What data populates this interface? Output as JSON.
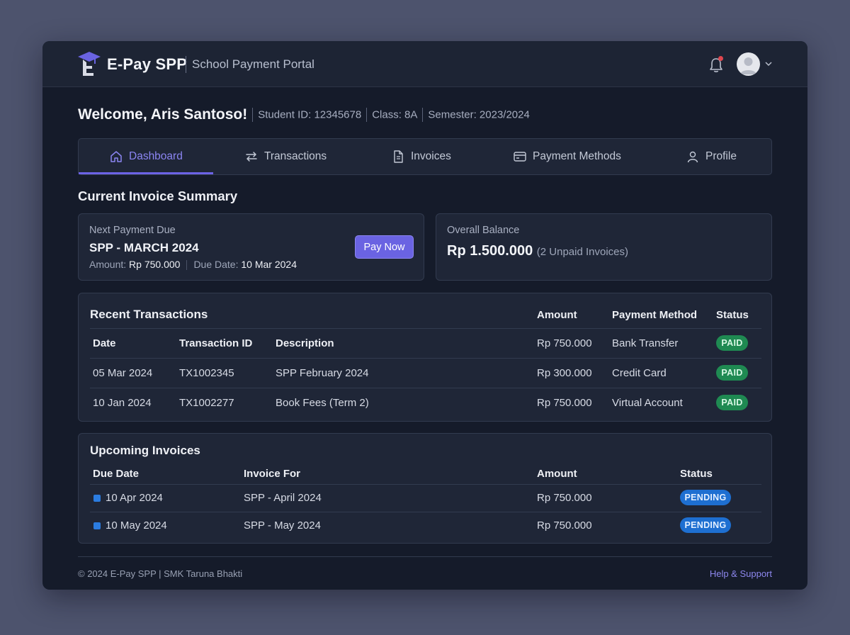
{
  "app": {
    "brand": "E-Pay SPP",
    "subtitle": "School Payment Portal"
  },
  "colors": {
    "accent": "#6a63e2",
    "paid": "#1f8a52",
    "pending": "#1e6fd1",
    "notification_dot": "#e0464e"
  },
  "header": {
    "notification_icon": "bell-icon",
    "avatar_icon": "user-avatar",
    "menu_icon": "chevron-down-icon"
  },
  "welcome": {
    "title": "Welcome, Aris Santoso!",
    "student_id": "Student ID: 12345678",
    "class": "Class: 8A",
    "semester": "Semester: 2023/2024"
  },
  "tabs": [
    {
      "label": "Dashboard",
      "icon": "home-icon",
      "active": true
    },
    {
      "label": "Transactions",
      "icon": "swap-icon",
      "active": false
    },
    {
      "label": "Invoices",
      "icon": "document-icon",
      "active": false
    },
    {
      "label": "Payment Methods",
      "icon": "card-icon",
      "active": false
    },
    {
      "label": "Profile",
      "icon": "user-icon",
      "active": false
    }
  ],
  "summary": {
    "title": "Current Invoice Summary",
    "next_due": {
      "label": "Next Payment Due",
      "title": "SPP - MARCH 2024",
      "amount_label": "Amount:",
      "amount": "Rp 750.000",
      "due_label": "Due Date:",
      "due_date": "10 Mar 2024",
      "pay_button": "Pay Now"
    },
    "balance": {
      "label": "Overall Balance",
      "value": "Rp 1.500.000",
      "note": "(2 Unpaid Invoices)"
    }
  },
  "recent": {
    "title": "Recent Transactions",
    "headers": {
      "date": "Date",
      "transaction_id": "Transaction ID",
      "description": "Description",
      "amount": "Amount",
      "method": "Payment Method",
      "status": "Status"
    },
    "header_row": {
      "amount": "Rp 750.000",
      "method": "Bank Transfer",
      "status": "PAID"
    },
    "rows": [
      {
        "date": "05 Mar 2024",
        "id": "TX1002345",
        "description": "SPP February 2024",
        "amount": "Rp 300.000",
        "method": "Credit Card",
        "status": "PAID"
      },
      {
        "date": "10 Jan 2024",
        "id": "TX1002277",
        "description": "Book Fees (Term 2)",
        "amount": "Rp 750.000",
        "method": "Virtual Account",
        "status": "PAID"
      }
    ]
  },
  "upcoming": {
    "title": "Upcoming Invoices",
    "headers": {
      "due_date": "Due Date",
      "invoice_for": "Invoice For",
      "amount": "Amount",
      "status": "Status"
    },
    "rows": [
      {
        "due_date": "10 Apr 2024",
        "invoice_for": "SPP - April 2024",
        "amount": "Rp 750.000",
        "status": "PENDING"
      },
      {
        "due_date": "10 May 2024",
        "invoice_for": "SPP - May 2024",
        "amount": "Rp 750.000",
        "status": "PENDING"
      }
    ]
  },
  "footer": {
    "copyright": "© 2024 E-Pay SPP | SMK Taruna Bhakti",
    "help": "Help & Support"
  }
}
